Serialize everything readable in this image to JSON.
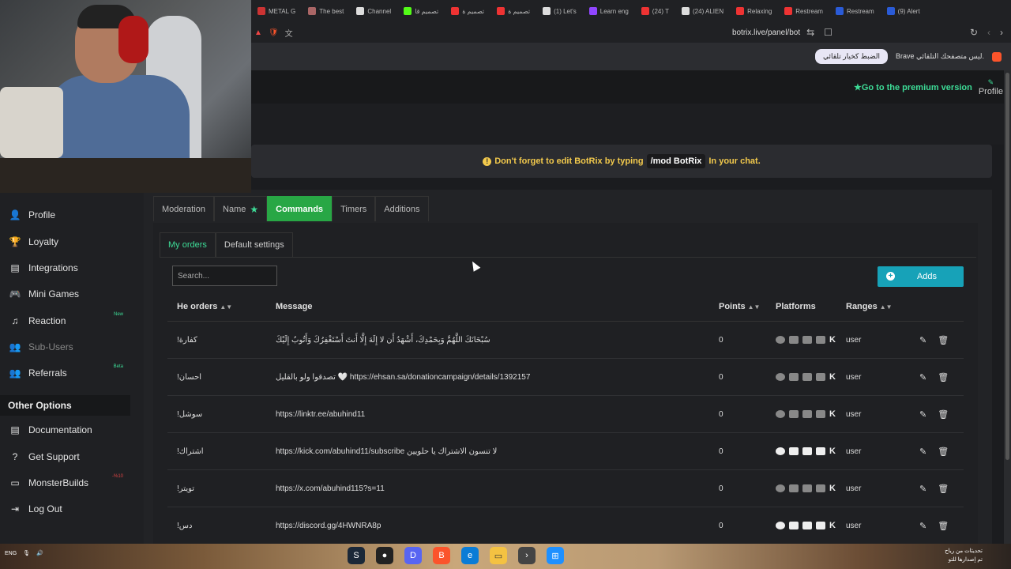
{
  "browser": {
    "tabs": [
      {
        "label": "METAL G",
        "color": "#c33"
      },
      {
        "label": "The best",
        "color": "#a66"
      },
      {
        "label": "Channel",
        "color": "#ddd"
      },
      {
        "label": "تصميم قا",
        "color": "#53fc18"
      },
      {
        "label": "تصميم ة",
        "color": "#e33"
      },
      {
        "label": "تصميم ة",
        "color": "#e33"
      },
      {
        "label": "(1) Let's",
        "color": "#ddd"
      },
      {
        "label": "Learn eng",
        "color": "#9146ff"
      },
      {
        "label": "(24) T",
        "color": "#e33"
      },
      {
        "label": "(24) ALIEN",
        "color": "#ddd"
      },
      {
        "label": "Relaxing",
        "color": "#e33"
      },
      {
        "label": "Restream",
        "color": "#e33"
      },
      {
        "label": "Restream",
        "color": "#2a5bd7"
      },
      {
        "label": "(9) Alert",
        "color": "#2a5bd7"
      }
    ],
    "url": "botrix.live/panel/bot",
    "notification_text": "Brave ليس متصفحك التلقائي.",
    "notification_button": "الضبط كخيار تلقائي"
  },
  "header": {
    "premium": "Go to the premium version",
    "profile": "Profile"
  },
  "alert": {
    "prefix": "Don't forget to edit BotRix by typing",
    "command": "/mod BotRix",
    "suffix": "In your chat."
  },
  "sidebar": {
    "items": [
      {
        "label": "Profile",
        "icon": "user-icon",
        "glyph": "👤"
      },
      {
        "label": "Loyalty",
        "icon": "trophy-icon",
        "glyph": "🏆"
      },
      {
        "label": "Integrations",
        "icon": "integrations-icon",
        "glyph": "▤"
      },
      {
        "label": "Mini Games",
        "icon": "gamepad-icon",
        "glyph": "🎮"
      },
      {
        "label": "Reaction",
        "icon": "music-icon",
        "glyph": "♫",
        "badge": "New"
      },
      {
        "label": "Sub-Users",
        "icon": "users-icon",
        "glyph": "👥"
      },
      {
        "label": "Referrals",
        "icon": "referrals-icon",
        "glyph": "👥",
        "badge": "Beta"
      }
    ],
    "other_header": "Other Options",
    "other_items": [
      {
        "label": "Documentation",
        "icon": "document-icon",
        "glyph": "▤"
      },
      {
        "label": "Get Support",
        "icon": "help-icon",
        "glyph": "?"
      },
      {
        "label": "MonsterBuilds",
        "icon": "monitor-icon",
        "glyph": "▭",
        "badge": "-%10"
      },
      {
        "label": "Log Out",
        "icon": "logout-icon",
        "glyph": "⇥"
      }
    ]
  },
  "main_tabs": [
    {
      "label": "Moderation",
      "active": false
    },
    {
      "label": "Name",
      "active": false,
      "star": true
    },
    {
      "label": "Commands",
      "active": true
    },
    {
      "label": "Timers",
      "active": false
    },
    {
      "label": "Additions",
      "active": false
    }
  ],
  "sub_tabs": [
    {
      "label": "My orders",
      "active": true
    },
    {
      "label": "Default settings",
      "active": false
    }
  ],
  "search": {
    "placeholder": "Search..."
  },
  "add_button": "Adds",
  "table": {
    "headers": {
      "order": "He orders",
      "message": "Message",
      "points": "Points",
      "platforms": "Platforms",
      "ranges": "Ranges"
    },
    "rows": [
      {
        "order": "!كفارة",
        "message": "سُبْحَانَكَ اللَّهُمَّ وَبِحَمْدِكَ، أَشْهَدُ أَن لا إِلَهَ إِلَّا أَنتَ أَسْتَغْفِرُكَ وَأَتُوبُ إِلَيْكَ",
        "points": "0",
        "range": "user",
        "bright": false
      },
      {
        "order": "!احسان",
        "message": "تصدقوا ولو بالقليل 🤍 https://ehsan.sa/donationcampaign/details/1392157",
        "points": "0",
        "range": "user",
        "bright": false
      },
      {
        "order": "!سوشل",
        "message": "https://linktr.ee/abuhind11",
        "points": "0",
        "range": "user",
        "bright": false
      },
      {
        "order": "!اشتراك",
        "message": "https://kick.com/abuhind11/subscribe لا تنسون الاشتراك يا حلويين",
        "points": "0",
        "range": "user",
        "bright": true
      },
      {
        "order": "!تويتر",
        "message": "https://x.com/abuhind115?s=11",
        "points": "0",
        "range": "user",
        "bright": false
      },
      {
        "order": "!دس",
        "message": "https://discord.gg/4HWNRA8p",
        "points": "0",
        "range": "user",
        "bright": true
      }
    ]
  },
  "taskbar": {
    "lang": "ENG",
    "right_line1": "تحديثات من رياح",
    "right_line2": "تم إصدارها للتو"
  }
}
